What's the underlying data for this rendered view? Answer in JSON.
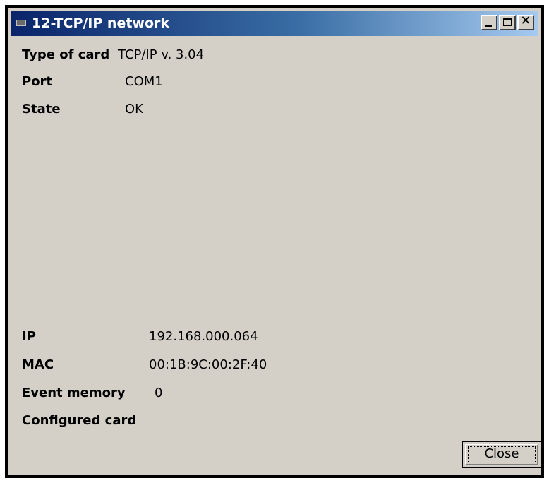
{
  "window": {
    "title": "12-TCP/IP network",
    "minimize_icon": "minimize-icon",
    "maximize_icon": "maximize-icon",
    "close_icon": "close-icon",
    "close_glyph": "✕"
  },
  "info": {
    "type_of_card": {
      "label": "Type of card",
      "value": "TCP/IP v. 3.04"
    },
    "port": {
      "label": "Port",
      "value": "COM1"
    },
    "state": {
      "label": "State",
      "value": "OK"
    },
    "ip": {
      "label": "IP",
      "value": "192.168.000.064"
    },
    "mac": {
      "label": "MAC",
      "value": "00:1B:9C:00:2F:40"
    },
    "event_memory": {
      "label": "Event memory",
      "value": "0"
    },
    "configured_card": {
      "label": "Configured card"
    }
  },
  "buttons": {
    "close_label": "Close"
  },
  "colors": {
    "titlebar_start": "#0a246a",
    "titlebar_end": "#a6caf0",
    "window_bg": "#d4d0c8"
  }
}
